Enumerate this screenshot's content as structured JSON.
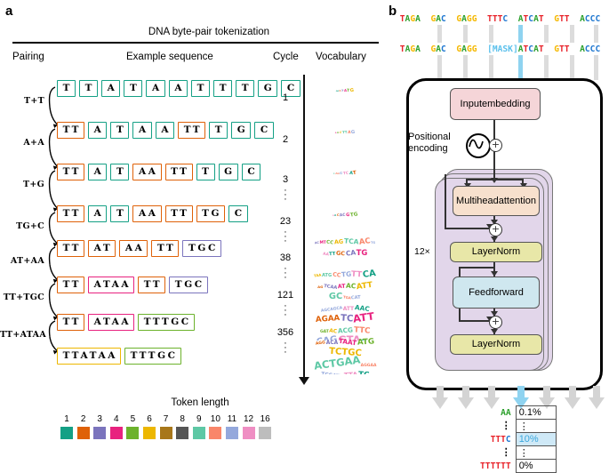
{
  "panels": {
    "a_letter": "a",
    "b_letter": "b"
  },
  "panel_a": {
    "title": "DNA byte-pair tokenization",
    "columns": {
      "pairing": "Pairing",
      "example": "Example sequence",
      "cycle": "Cycle",
      "vocabulary": "Vocabulary"
    },
    "pairings": [
      "T+T",
      "A+A",
      "T+G",
      "TG+C",
      "AT+AA",
      "TT+TGC",
      "TT+ATAA"
    ],
    "rows": [
      {
        "cycle": "1",
        "tokens": [
          {
            "text": "T",
            "len": 1
          },
          {
            "text": "T",
            "len": 1
          },
          {
            "text": "A",
            "len": 1
          },
          {
            "text": "T",
            "len": 1
          },
          {
            "text": "A",
            "len": 1
          },
          {
            "text": "A",
            "len": 1
          },
          {
            "text": "T",
            "len": 1
          },
          {
            "text": "T",
            "len": 1
          },
          {
            "text": "T",
            "len": 1
          },
          {
            "text": "G",
            "len": 1
          },
          {
            "text": "C",
            "len": 1
          }
        ]
      },
      {
        "cycle": "2",
        "tokens": [
          {
            "text": "TT",
            "len": 2
          },
          {
            "text": "A",
            "len": 1
          },
          {
            "text": "T",
            "len": 1
          },
          {
            "text": "A",
            "len": 1
          },
          {
            "text": "A",
            "len": 1
          },
          {
            "text": "TT",
            "len": 2
          },
          {
            "text": "T",
            "len": 1
          },
          {
            "text": "G",
            "len": 1
          },
          {
            "text": "C",
            "len": 1
          }
        ]
      },
      {
        "cycle": "3",
        "tokens": [
          {
            "text": "TT",
            "len": 2
          },
          {
            "text": "A",
            "len": 1
          },
          {
            "text": "T",
            "len": 1
          },
          {
            "text": "AA",
            "len": 2
          },
          {
            "text": "TT",
            "len": 2
          },
          {
            "text": "T",
            "len": 1
          },
          {
            "text": "G",
            "len": 1
          },
          {
            "text": "C",
            "len": 1
          }
        ]
      },
      {
        "cycle": "23",
        "tokens": [
          {
            "text": "TT",
            "len": 2
          },
          {
            "text": "A",
            "len": 1
          },
          {
            "text": "T",
            "len": 1
          },
          {
            "text": "AA",
            "len": 2
          },
          {
            "text": "TT",
            "len": 2
          },
          {
            "text": "TG",
            "len": 2
          },
          {
            "text": "C",
            "len": 1
          }
        ]
      },
      {
        "cycle": "38",
        "tokens": [
          {
            "text": "TT",
            "len": 2
          },
          {
            "text": "AT",
            "len": 2
          },
          {
            "text": "AA",
            "len": 2
          },
          {
            "text": "TT",
            "len": 2
          },
          {
            "text": "TGC",
            "len": 3
          }
        ]
      },
      {
        "cycle": "121",
        "tokens": [
          {
            "text": "TT",
            "len": 2
          },
          {
            "text": "ATAA",
            "len": 4
          },
          {
            "text": "TT",
            "len": 2
          },
          {
            "text": "TGC",
            "len": 3
          }
        ]
      },
      {
        "cycle": "356",
        "tokens": [
          {
            "text": "TT",
            "len": 2
          },
          {
            "text": "ATAA",
            "len": 4
          },
          {
            "text": "TTTGC",
            "len": 5
          }
        ]
      },
      {
        "cycle": "",
        "tokens": [
          {
            "text": "TTATAA",
            "len": 6
          },
          {
            "text": "TTTGC",
            "len": 5
          }
        ]
      }
    ],
    "vocab_clouds": [
      {
        "scale": 0.18,
        "words": [
          "GA",
          "C",
          "T",
          "A",
          "T",
          "G"
        ]
      },
      {
        "scale": 0.2,
        "words": [
          "G",
          "A",
          "C",
          "TT",
          "A",
          "G"
        ]
      },
      {
        "scale": 0.26,
        "words": [
          "C",
          "AG",
          "G",
          "TC",
          "A",
          "T"
        ]
      },
      {
        "scale": 0.26,
        "words": [
          "G",
          "A",
          "C",
          "AC",
          "G",
          "TG"
        ]
      },
      {
        "scale": 0.62,
        "words": [
          "AC",
          "MT",
          "CC",
          "AG",
          "TCA",
          "AC",
          "TG",
          "AA",
          "TT",
          "GC",
          "CA",
          "TG"
        ]
      },
      {
        "scale": 0.8,
        "words": [
          "TAA",
          "ATG",
          "CC",
          "TG",
          "TT",
          "CA",
          "AG",
          "TCAA",
          "AT",
          "AC",
          "ATT",
          "GC",
          "TGA",
          "CAT"
        ]
      },
      {
        "scale": 1.0,
        "words": [
          "AGCAGCA",
          "ATT",
          "AAC",
          "AGAA",
          "TC",
          "ATT",
          "GAT",
          "AC",
          "ACG",
          "TTC",
          "CAG",
          "GTA",
          "TGCA",
          "AGG",
          "CCA",
          "TTG",
          "AAT",
          "GC"
        ]
      },
      {
        "scale": 1.0,
        "words": [
          "AGG",
          "ACA",
          "TAAT",
          "ATG",
          "TCTGC",
          "ACTGAA",
          "AGGAA",
          "TCCATT",
          "TTA",
          "TC",
          "GAC",
          "TTG",
          "CAA"
        ]
      }
    ],
    "legend": {
      "title": "Token length",
      "items": [
        {
          "label": "1",
          "color": "#14a085"
        },
        {
          "label": "2",
          "color": "#df6108"
        },
        {
          "label": "3",
          "color": "#7b74bd"
        },
        {
          "label": "4",
          "color": "#e8227f"
        },
        {
          "label": "5",
          "color": "#6cb22c"
        },
        {
          "label": "6",
          "color": "#edb700"
        },
        {
          "label": "7",
          "color": "#a8771a"
        },
        {
          "label": "8",
          "color": "#555555"
        },
        {
          "label": "9",
          "color": "#5ec8a5"
        },
        {
          "label": "10",
          "color": "#f9866a"
        },
        {
          "label": "11",
          "color": "#94a8dc"
        },
        {
          "label": "12",
          "color": "#ef8ec3"
        },
        {
          "label": "16",
          "color": "#bdbdbd"
        }
      ]
    }
  },
  "panel_b": {
    "input_sequence": "TAGA GAC GAGG TTTC ATCAT GTT ACCC",
    "masked_sequence": "TAGA GAC GAGG [MASK]ATCAT GTT ACCC",
    "mask_token": "[MASK]",
    "nodes": {
      "input_embedding": "Input\nembedding",
      "positional_encoding": "Positional\nencoding",
      "multihead_attention": "Multihead\nattention",
      "layernorm_1": "LayerNorm",
      "feed_forward": "Feed\nforward",
      "layernorm_2": "LayerNorm",
      "repeat": "12×"
    },
    "predictions": [
      {
        "seq": "AA",
        "value": "0.1%",
        "highlight": false
      },
      {
        "seq": "⋮",
        "value": "⋮",
        "highlight": false
      },
      {
        "seq": "TTTC",
        "value": "10%",
        "highlight": true
      },
      {
        "seq": "⋮",
        "value": "⋮",
        "highlight": false
      },
      {
        "seq": "TTTTTT",
        "value": "0%",
        "highlight": false
      }
    ],
    "base_colors": {
      "A": "#2ca02c",
      "T": "#e8232a",
      "G": "#f5b800",
      "C": "#1f77d0",
      "mask": "#5bc0ec"
    },
    "arrow_count": 7,
    "highlight_arrow_index": 3
  }
}
